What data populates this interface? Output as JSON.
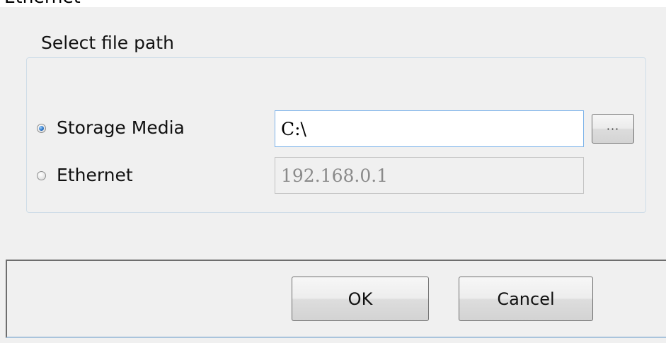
{
  "window": {
    "title": "Ethernet"
  },
  "group": {
    "legend": "Select file path"
  },
  "options": [
    {
      "label": "Storage Media",
      "checked": true,
      "field_value": "C:\\",
      "field_state": "enabled"
    },
    {
      "label": "Ethernet",
      "checked": false,
      "field_value": "192.168.0.1",
      "field_state": "disabled"
    }
  ],
  "browse": {
    "label": "···"
  },
  "footer": {
    "ok_label": "OK",
    "cancel_label": "Cancel"
  },
  "colors": {
    "background": "#f0f0f0",
    "field_focus_border": "#7eb4ea",
    "radio_selected": "#2f77c9",
    "disabled_text": "#8a8a8a"
  }
}
